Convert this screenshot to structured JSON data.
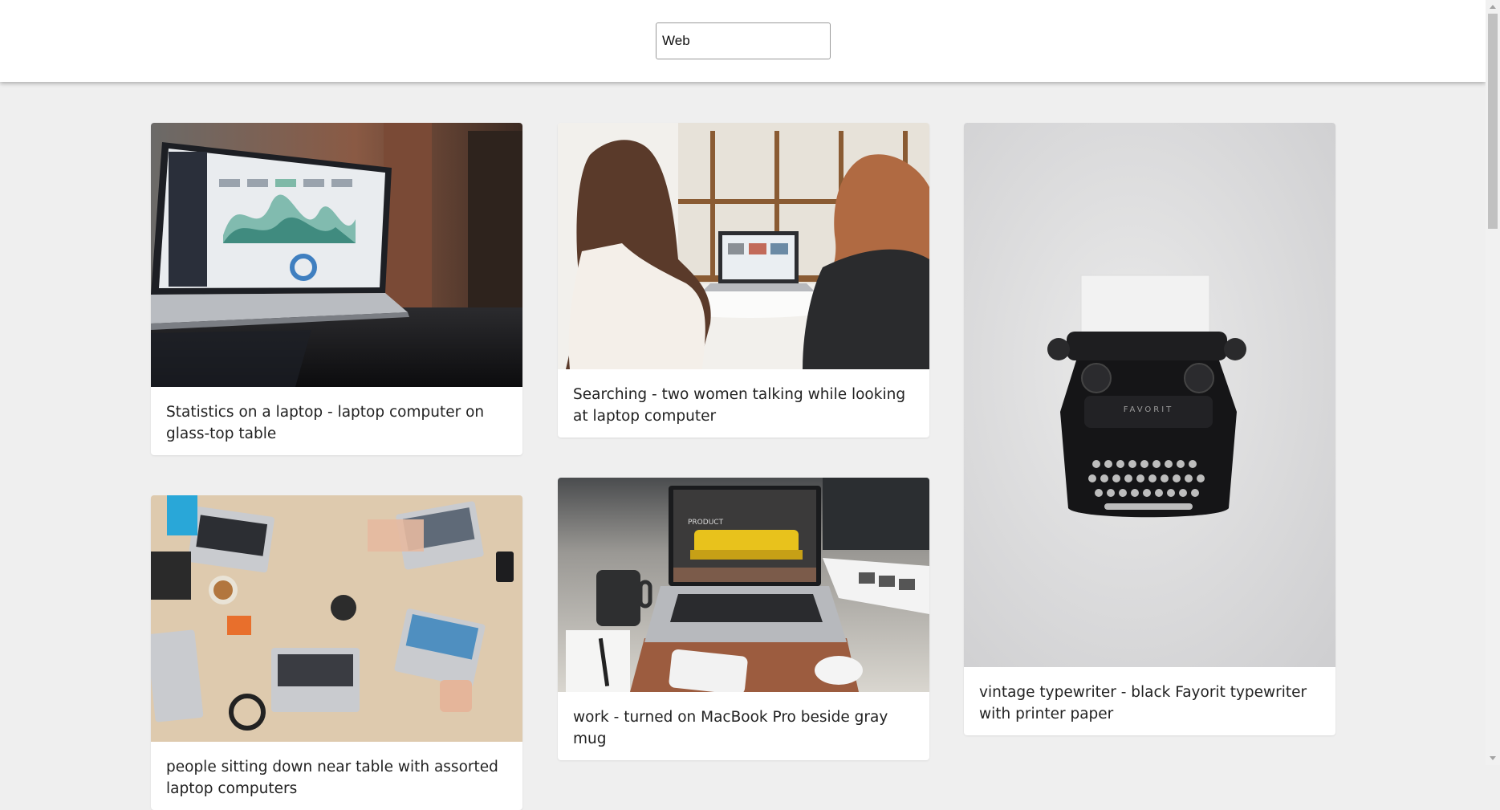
{
  "search": {
    "value": "Web"
  },
  "cards": [
    {
      "caption": "Statistics on a laptop - laptop computer on glass-top table",
      "image": "laptop-statistics-image"
    },
    {
      "caption": "Searching - two women talking while looking at laptop computer",
      "image": "two-women-laptop-image"
    },
    {
      "caption": "vintage typewriter - black Fayorit typewriter with printer paper",
      "image": "typewriter-image"
    },
    {
      "caption": "people sitting down near table with assorted laptop computers",
      "image": "team-laptops-table-image"
    },
    {
      "caption": "work - turned on MacBook Pro beside gray mug",
      "image": "macbook-mug-image"
    }
  ]
}
